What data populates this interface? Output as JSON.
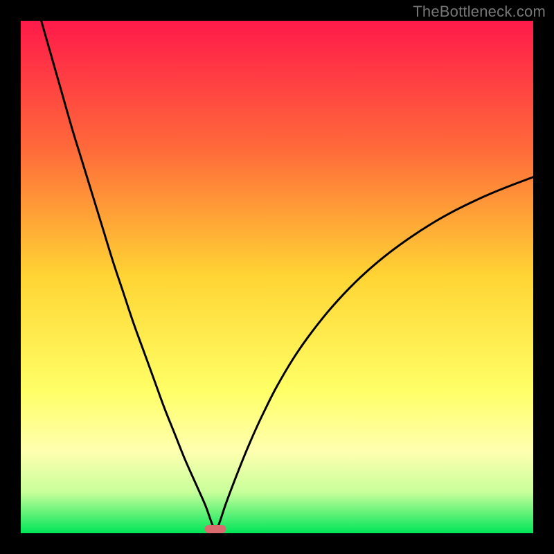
{
  "watermark": {
    "text": "TheBottleneck.com"
  },
  "chart_data": {
    "type": "line",
    "title": "",
    "xlabel": "",
    "ylabel": "",
    "xlim": [
      0,
      100
    ],
    "ylim": [
      0,
      100
    ],
    "gradient_stops": [
      {
        "offset": 0,
        "color": "#ff1a4a"
      },
      {
        "offset": 0.25,
        "color": "#ff6a3a"
      },
      {
        "offset": 0.5,
        "color": "#ffd534"
      },
      {
        "offset": 0.72,
        "color": "#ffff66"
      },
      {
        "offset": 0.84,
        "color": "#ffffb0"
      },
      {
        "offset": 0.92,
        "color": "#c8ff9a"
      },
      {
        "offset": 1.0,
        "color": "#00e558"
      }
    ],
    "optimum_x": 38,
    "marker": {
      "x": 38,
      "width_pct": 4.2,
      "color": "#d96b6e"
    },
    "series": [
      {
        "name": "curve-left",
        "x": [
          4,
          6,
          8,
          10,
          12,
          14,
          16,
          18,
          20,
          22,
          24,
          26,
          28,
          30,
          32,
          34,
          36,
          37,
          38
        ],
        "y": [
          100,
          93,
          86,
          79,
          72.5,
          66,
          59.5,
          53,
          47,
          41,
          35.5,
          30,
          24.5,
          19.5,
          14.5,
          10,
          5.5,
          2.7,
          0
        ]
      },
      {
        "name": "curve-right",
        "x": [
          38,
          39,
          40,
          42,
          44,
          46,
          48,
          50,
          53,
          56,
          60,
          64,
          68,
          72,
          76,
          80,
          84,
          88,
          92,
          96,
          100
        ],
        "y": [
          0,
          2.7,
          5.7,
          11,
          16,
          20.6,
          24.8,
          28.7,
          33.8,
          38.2,
          43.3,
          47.7,
          51.5,
          54.8,
          57.7,
          60.3,
          62.6,
          64.6,
          66.4,
          68.0,
          69.5
        ]
      }
    ]
  }
}
